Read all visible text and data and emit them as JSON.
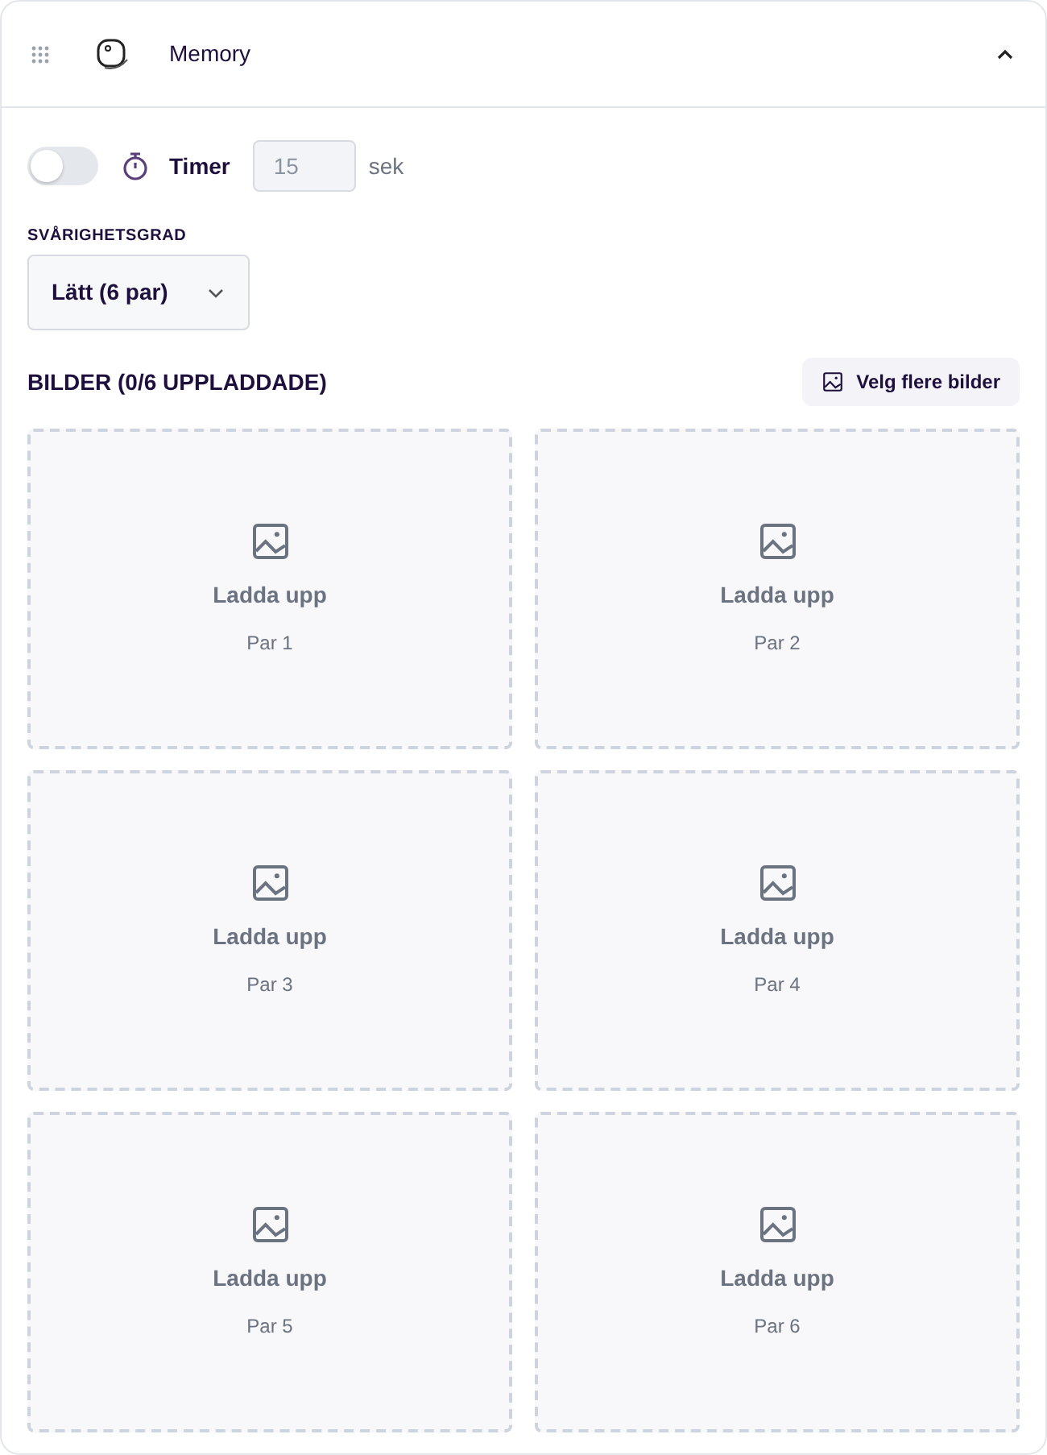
{
  "header": {
    "title": "Memory",
    "expanded": true
  },
  "timer": {
    "on": false,
    "label": "Timer",
    "value": "15",
    "disabled": true,
    "unit": "sek"
  },
  "difficulty": {
    "label": "SVÅRIGHETSGRAD",
    "value": "Lätt (6 par)"
  },
  "images": {
    "heading": "BILDER (0/6 UPPLADDADE)",
    "button": "Velg flere bilder",
    "slots": [
      {
        "label": "Ladda upp",
        "sublabel": "Par 1"
      },
      {
        "label": "Ladda upp",
        "sublabel": "Par 2"
      },
      {
        "label": "Ladda upp",
        "sublabel": "Par 3"
      },
      {
        "label": "Ladda upp",
        "sublabel": "Par 4"
      },
      {
        "label": "Ladda upp",
        "sublabel": "Par 5"
      },
      {
        "label": "Ladda upp",
        "sublabel": "Par 6"
      }
    ]
  }
}
